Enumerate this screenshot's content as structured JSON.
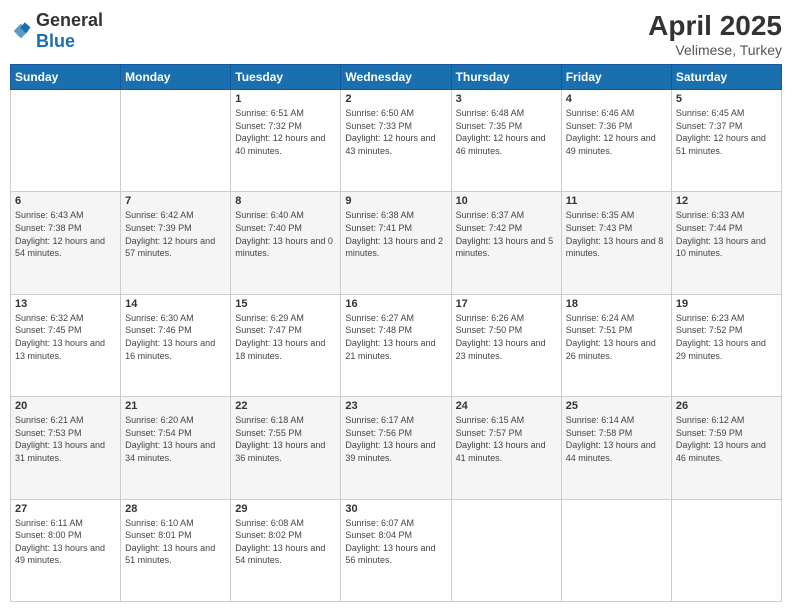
{
  "header": {
    "logo_general": "General",
    "logo_blue": "Blue",
    "title": "April 2025",
    "location": "Velimese, Turkey"
  },
  "weekdays": [
    "Sunday",
    "Monday",
    "Tuesday",
    "Wednesday",
    "Thursday",
    "Friday",
    "Saturday"
  ],
  "weeks": [
    [
      {
        "day": "",
        "sunrise": "",
        "sunset": "",
        "daylight": ""
      },
      {
        "day": "",
        "sunrise": "",
        "sunset": "",
        "daylight": ""
      },
      {
        "day": "1",
        "sunrise": "Sunrise: 6:51 AM",
        "sunset": "Sunset: 7:32 PM",
        "daylight": "Daylight: 12 hours and 40 minutes."
      },
      {
        "day": "2",
        "sunrise": "Sunrise: 6:50 AM",
        "sunset": "Sunset: 7:33 PM",
        "daylight": "Daylight: 12 hours and 43 minutes."
      },
      {
        "day": "3",
        "sunrise": "Sunrise: 6:48 AM",
        "sunset": "Sunset: 7:35 PM",
        "daylight": "Daylight: 12 hours and 46 minutes."
      },
      {
        "day": "4",
        "sunrise": "Sunrise: 6:46 AM",
        "sunset": "Sunset: 7:36 PM",
        "daylight": "Daylight: 12 hours and 49 minutes."
      },
      {
        "day": "5",
        "sunrise": "Sunrise: 6:45 AM",
        "sunset": "Sunset: 7:37 PM",
        "daylight": "Daylight: 12 hours and 51 minutes."
      }
    ],
    [
      {
        "day": "6",
        "sunrise": "Sunrise: 6:43 AM",
        "sunset": "Sunset: 7:38 PM",
        "daylight": "Daylight: 12 hours and 54 minutes."
      },
      {
        "day": "7",
        "sunrise": "Sunrise: 6:42 AM",
        "sunset": "Sunset: 7:39 PM",
        "daylight": "Daylight: 12 hours and 57 minutes."
      },
      {
        "day": "8",
        "sunrise": "Sunrise: 6:40 AM",
        "sunset": "Sunset: 7:40 PM",
        "daylight": "Daylight: 13 hours and 0 minutes."
      },
      {
        "day": "9",
        "sunrise": "Sunrise: 6:38 AM",
        "sunset": "Sunset: 7:41 PM",
        "daylight": "Daylight: 13 hours and 2 minutes."
      },
      {
        "day": "10",
        "sunrise": "Sunrise: 6:37 AM",
        "sunset": "Sunset: 7:42 PM",
        "daylight": "Daylight: 13 hours and 5 minutes."
      },
      {
        "day": "11",
        "sunrise": "Sunrise: 6:35 AM",
        "sunset": "Sunset: 7:43 PM",
        "daylight": "Daylight: 13 hours and 8 minutes."
      },
      {
        "day": "12",
        "sunrise": "Sunrise: 6:33 AM",
        "sunset": "Sunset: 7:44 PM",
        "daylight": "Daylight: 13 hours and 10 minutes."
      }
    ],
    [
      {
        "day": "13",
        "sunrise": "Sunrise: 6:32 AM",
        "sunset": "Sunset: 7:45 PM",
        "daylight": "Daylight: 13 hours and 13 minutes."
      },
      {
        "day": "14",
        "sunrise": "Sunrise: 6:30 AM",
        "sunset": "Sunset: 7:46 PM",
        "daylight": "Daylight: 13 hours and 16 minutes."
      },
      {
        "day": "15",
        "sunrise": "Sunrise: 6:29 AM",
        "sunset": "Sunset: 7:47 PM",
        "daylight": "Daylight: 13 hours and 18 minutes."
      },
      {
        "day": "16",
        "sunrise": "Sunrise: 6:27 AM",
        "sunset": "Sunset: 7:48 PM",
        "daylight": "Daylight: 13 hours and 21 minutes."
      },
      {
        "day": "17",
        "sunrise": "Sunrise: 6:26 AM",
        "sunset": "Sunset: 7:50 PM",
        "daylight": "Daylight: 13 hours and 23 minutes."
      },
      {
        "day": "18",
        "sunrise": "Sunrise: 6:24 AM",
        "sunset": "Sunset: 7:51 PM",
        "daylight": "Daylight: 13 hours and 26 minutes."
      },
      {
        "day": "19",
        "sunrise": "Sunrise: 6:23 AM",
        "sunset": "Sunset: 7:52 PM",
        "daylight": "Daylight: 13 hours and 29 minutes."
      }
    ],
    [
      {
        "day": "20",
        "sunrise": "Sunrise: 6:21 AM",
        "sunset": "Sunset: 7:53 PM",
        "daylight": "Daylight: 13 hours and 31 minutes."
      },
      {
        "day": "21",
        "sunrise": "Sunrise: 6:20 AM",
        "sunset": "Sunset: 7:54 PM",
        "daylight": "Daylight: 13 hours and 34 minutes."
      },
      {
        "day": "22",
        "sunrise": "Sunrise: 6:18 AM",
        "sunset": "Sunset: 7:55 PM",
        "daylight": "Daylight: 13 hours and 36 minutes."
      },
      {
        "day": "23",
        "sunrise": "Sunrise: 6:17 AM",
        "sunset": "Sunset: 7:56 PM",
        "daylight": "Daylight: 13 hours and 39 minutes."
      },
      {
        "day": "24",
        "sunrise": "Sunrise: 6:15 AM",
        "sunset": "Sunset: 7:57 PM",
        "daylight": "Daylight: 13 hours and 41 minutes."
      },
      {
        "day": "25",
        "sunrise": "Sunrise: 6:14 AM",
        "sunset": "Sunset: 7:58 PM",
        "daylight": "Daylight: 13 hours and 44 minutes."
      },
      {
        "day": "26",
        "sunrise": "Sunrise: 6:12 AM",
        "sunset": "Sunset: 7:59 PM",
        "daylight": "Daylight: 13 hours and 46 minutes."
      }
    ],
    [
      {
        "day": "27",
        "sunrise": "Sunrise: 6:11 AM",
        "sunset": "Sunset: 8:00 PM",
        "daylight": "Daylight: 13 hours and 49 minutes."
      },
      {
        "day": "28",
        "sunrise": "Sunrise: 6:10 AM",
        "sunset": "Sunset: 8:01 PM",
        "daylight": "Daylight: 13 hours and 51 minutes."
      },
      {
        "day": "29",
        "sunrise": "Sunrise: 6:08 AM",
        "sunset": "Sunset: 8:02 PM",
        "daylight": "Daylight: 13 hours and 54 minutes."
      },
      {
        "day": "30",
        "sunrise": "Sunrise: 6:07 AM",
        "sunset": "Sunset: 8:04 PM",
        "daylight": "Daylight: 13 hours and 56 minutes."
      },
      {
        "day": "",
        "sunrise": "",
        "sunset": "",
        "daylight": ""
      },
      {
        "day": "",
        "sunrise": "",
        "sunset": "",
        "daylight": ""
      },
      {
        "day": "",
        "sunrise": "",
        "sunset": "",
        "daylight": ""
      }
    ]
  ]
}
